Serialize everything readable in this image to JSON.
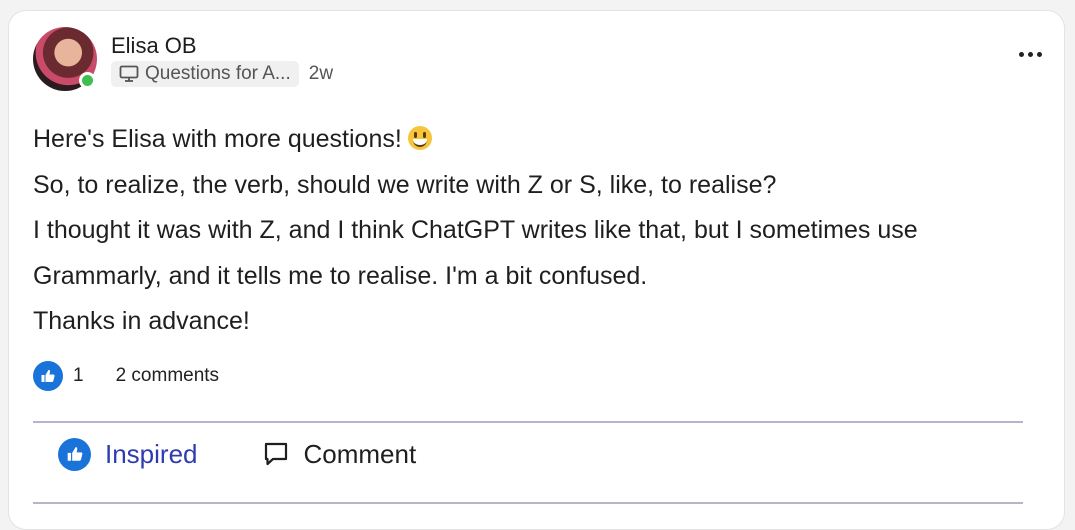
{
  "post": {
    "author": "Elisa OB",
    "group": "Questions for A...",
    "time": "2w",
    "lines": [
      "Here's Elisa with more questions!",
      "So, to realize, the verb, should we write with Z or S, like, to realise?",
      "I thought it was with Z, and I think ChatGPT writes like that, but I sometimes use",
      "Grammarly, and it tells me to realise. I'm a bit confused.",
      "Thanks in advance!"
    ],
    "likes": "1",
    "comments": "2 comments"
  },
  "actions": {
    "inspired": "Inspired",
    "comment": "Comment"
  },
  "icons": [
    "avatar",
    "monitor-icon",
    "more-options-icon",
    "smiley-emoji-icon",
    "thumbs-up-icon",
    "comment-bubble-icon"
  ],
  "colors": {
    "accent": "#2f3cb0",
    "like_blue": "#1a73d9",
    "online": "#3fbf4f",
    "divider": "#b4b7cc"
  }
}
